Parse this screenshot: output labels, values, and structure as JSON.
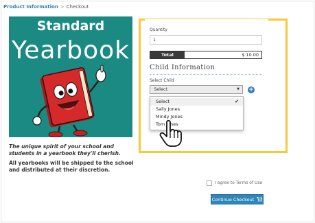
{
  "breadcrumb": {
    "first": "Product Information",
    "separator": ">",
    "current": "Checkout"
  },
  "hero": {
    "title": "Standard",
    "word": "Yearbook"
  },
  "description": {
    "line1": "The unique spirit of your school and students in a yearbook they'll cherish.",
    "line2": "All yearbooks will be shipped to the school and distributed at their discretion."
  },
  "form": {
    "quantity_label": "Quantity",
    "quantity_value": "1",
    "total_label": "Total",
    "total_value": "$ 10.00",
    "child_heading": "Child Information",
    "select_label": "Select Child",
    "select_value": "Select",
    "options": [
      "Select",
      "Sally Jones",
      "Mindy Jones",
      "Tom Jones"
    ],
    "selected_index": 0
  },
  "terms_label": "I agree to Terms of Use",
  "continue_label": "Continue Checkout",
  "icons": {
    "add": "plus-circle-icon",
    "cart": "cart-icon",
    "check": "checkmark-icon",
    "caret": "caret-down-icon",
    "cursor": "hand-pointer-icon"
  },
  "colors": {
    "accent": "#2e86b9",
    "highlight": "#f6c83a",
    "hero_bg": "#1b8a82",
    "book": "#d62a2a"
  }
}
